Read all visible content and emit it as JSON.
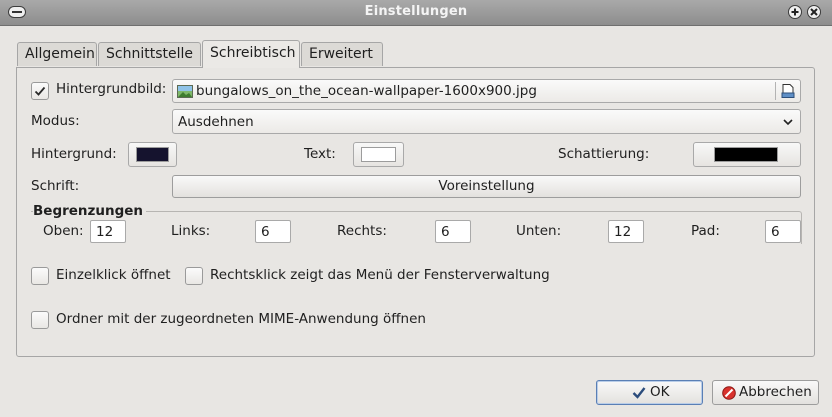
{
  "window": {
    "title": "Einstellungen"
  },
  "tabs": [
    {
      "label": "Allgemein"
    },
    {
      "label": "Schnittstelle"
    },
    {
      "label": "Schreibtisch"
    },
    {
      "label": "Erweitert"
    }
  ],
  "wallpaper": {
    "checkbox_label": "Hintergrundbild:",
    "checked": true,
    "file": "bungalows_on_the_ocean-wallpaper-1600x900.jpg"
  },
  "mode": {
    "label": "Modus:",
    "value": "Ausdehnen"
  },
  "colors": {
    "background_label": "Hintergrund:",
    "background_color": "#15132e",
    "text_label": "Text:",
    "text_color": "#ffffff",
    "shadow_label": "Schattierung:",
    "shadow_color": "#000000"
  },
  "font": {
    "label": "Schrift:",
    "value": "Voreinstellung"
  },
  "margins": {
    "title": "Begrenzungen",
    "top_label": "Oben:",
    "top": "12",
    "left_label": "Links:",
    "left": "6",
    "right_label": "Rechts:",
    "right": "6",
    "bottom_label": "Unten:",
    "bottom": "12",
    "pad_label": "Pad:",
    "pad": "6"
  },
  "options": {
    "single_click": "Einzelklick öffnet",
    "right_click_menu": "Rechtsklick zeigt das Menü der Fensterverwaltung",
    "open_folder_mime": "Ordner mit der zugeordneten MIME-Anwendung öffnen"
  },
  "buttons": {
    "ok": "OK",
    "cancel": "Abbrechen"
  }
}
